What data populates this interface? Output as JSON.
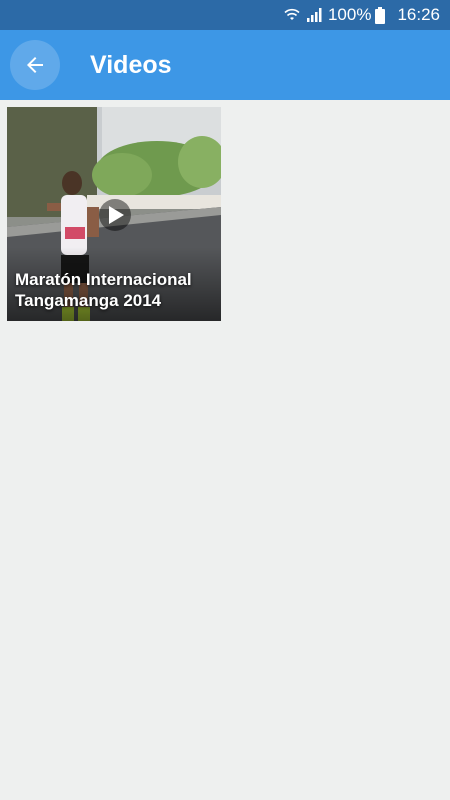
{
  "status_bar": {
    "battery": "100%",
    "time": "16:26",
    "icons": [
      "wifi-icon",
      "signal-icon",
      "battery-icon"
    ]
  },
  "app_bar": {
    "title": "Videos",
    "back_icon": "arrow-left-icon"
  },
  "videos": [
    {
      "title": "Maratón Internacional Tangamanga 2014",
      "icon": "play-icon"
    }
  ],
  "colors": {
    "status_bar": "#2c6aa7",
    "app_bar": "#3d97e6",
    "background": "#eef0ef"
  }
}
